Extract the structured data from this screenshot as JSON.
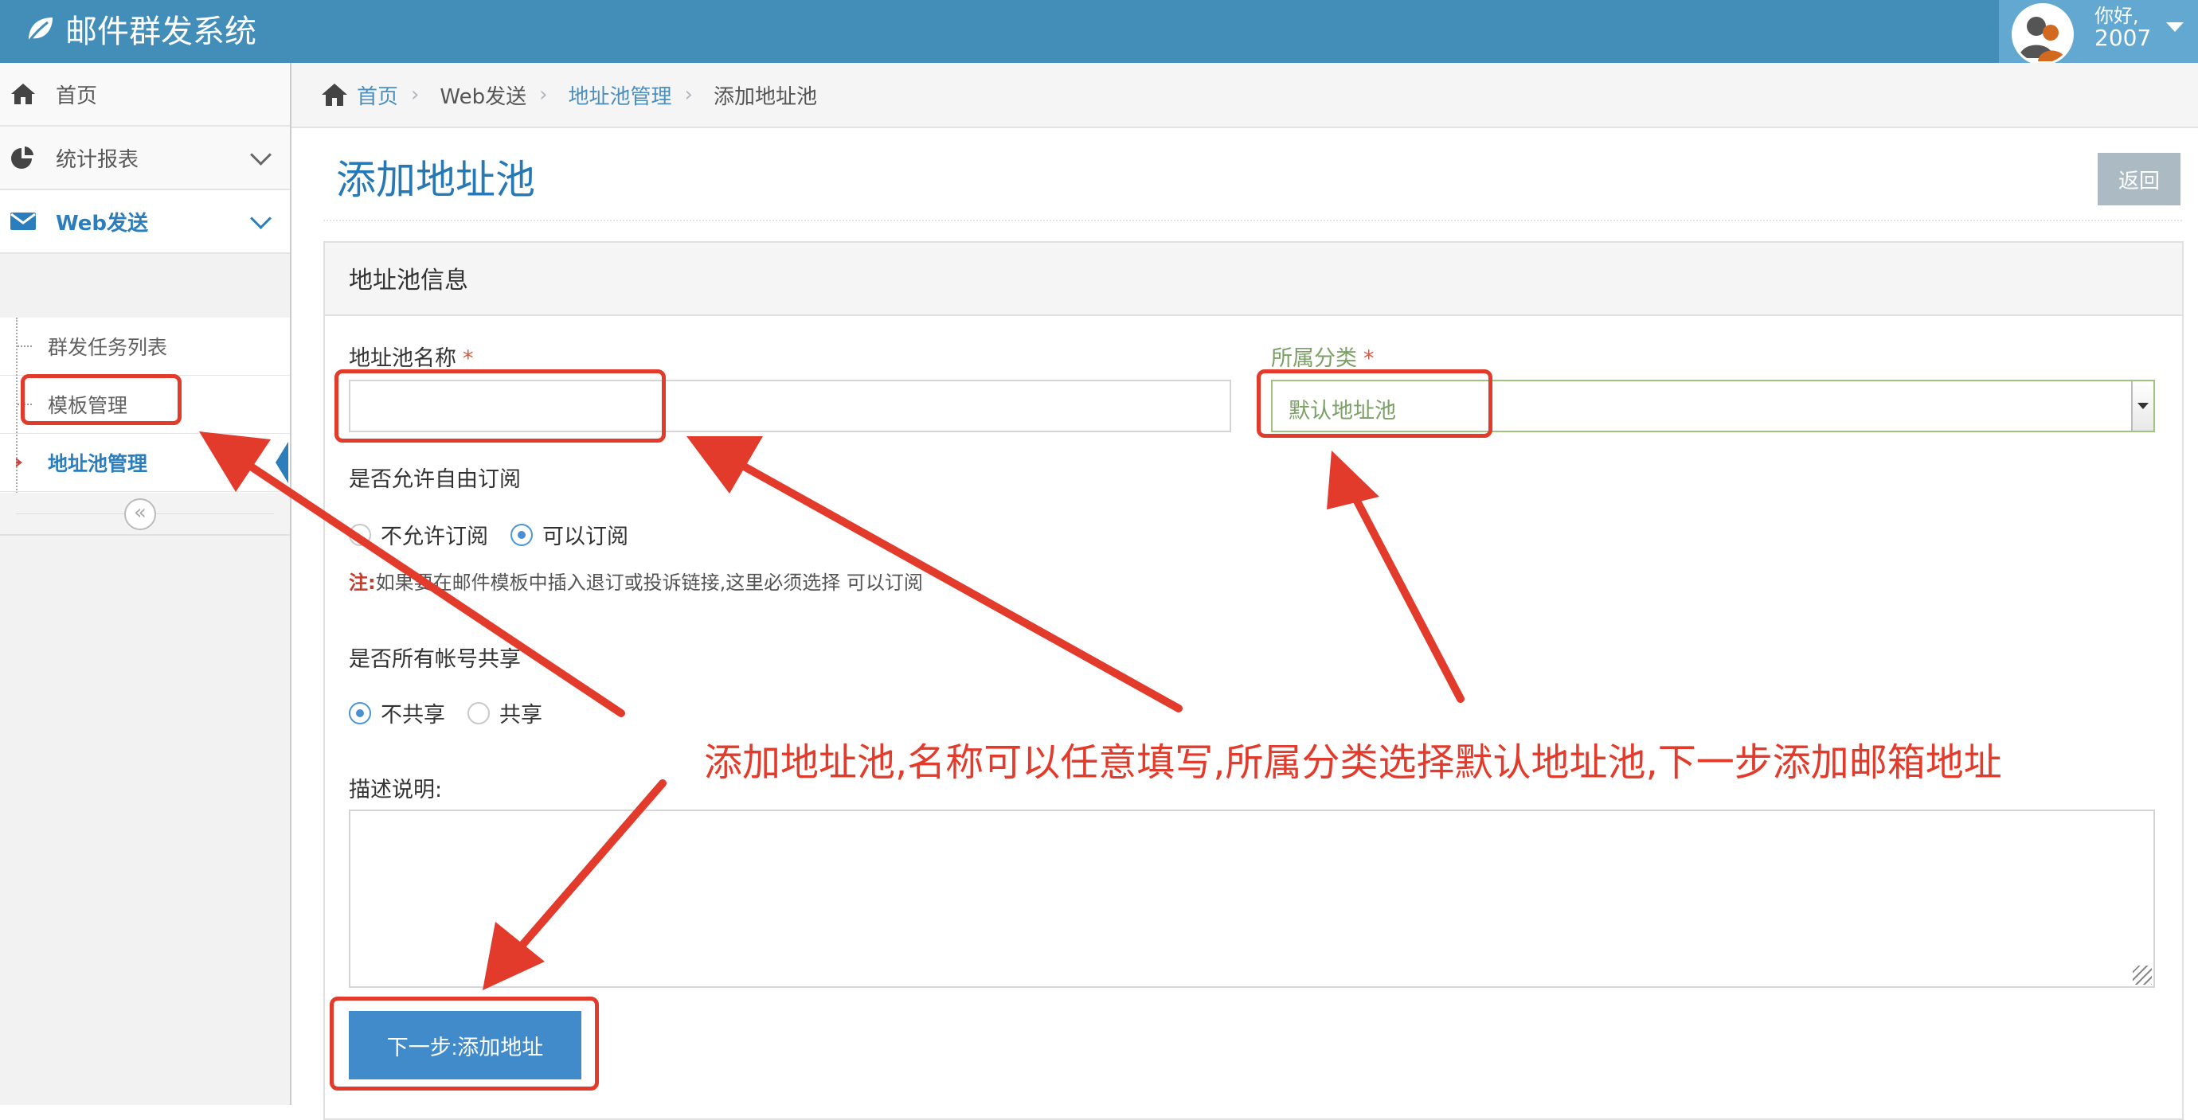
{
  "app": {
    "title": "邮件群发系统"
  },
  "user": {
    "greeting": "你好,",
    "name": "2007"
  },
  "sidebar": {
    "items": [
      {
        "label": "首页",
        "icon": "home-icon"
      },
      {
        "label": "统计报表",
        "icon": "pie-chart-icon"
      },
      {
        "label": "Web发送",
        "icon": "envelope-icon"
      }
    ],
    "submenu": [
      {
        "label": "群发任务列表"
      },
      {
        "label": "模板管理"
      },
      {
        "label": "地址池管理"
      }
    ],
    "collapse_label": "«"
  },
  "breadcrumb": {
    "home": "首页",
    "web_send": "Web发送",
    "pool_manage": "地址池管理",
    "current": "添加地址池"
  },
  "page": {
    "title": "添加地址池",
    "back_label": "返回"
  },
  "form": {
    "section_title": "地址池信息",
    "name_label": "地址池名称",
    "required_mark": "*",
    "name_value": "",
    "category_label": "所属分类",
    "category_value": "默认地址池",
    "subscribe_label": "是否允许自由订阅",
    "subscribe_options": [
      "不允许订阅",
      "可以订阅"
    ],
    "subscribe_selected": "可以订阅",
    "note_prefix": "注:",
    "note_text": "如果要在邮件模板中插入退订或投诉链接,这里必须选择 可以订阅",
    "share_label": "是否所有帐号共享",
    "share_options": [
      "不共享",
      "共享"
    ],
    "share_selected": "不共享",
    "desc_label": "描述说明:",
    "desc_value": "",
    "next_label": "下一步:添加地址"
  },
  "annotation": {
    "text": "添加地址池,名称可以任意填写,所属分类选择默认地址池,下一步添加邮箱地址",
    "color": "#e23b2c"
  },
  "colors": {
    "nav": "#438eb9",
    "accent": "#2679b5",
    "button": "#428bca"
  }
}
